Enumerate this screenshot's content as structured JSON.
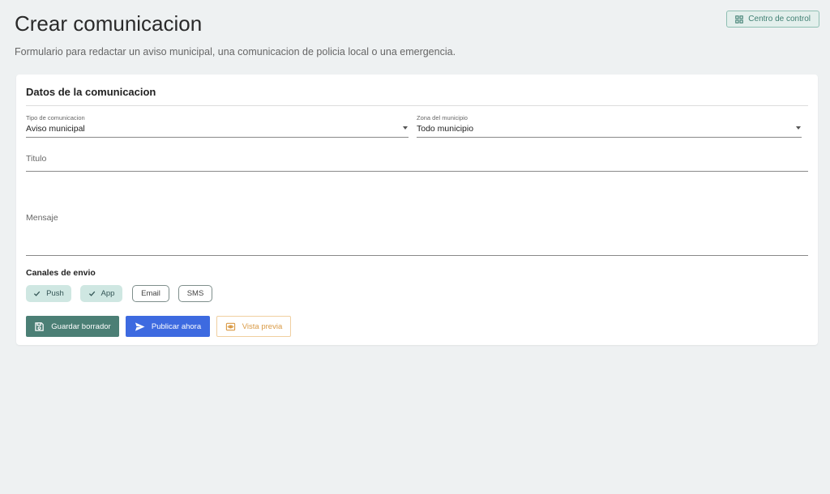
{
  "header": {
    "title": "Crear comunicacion",
    "subtitle": "Formulario para redactar un aviso municipal, una comunicacion de policia local o una emergencia.",
    "dashboard_label": "Centro de control"
  },
  "form": {
    "section_title": "Datos de la comunicacion",
    "type_select": {
      "label": "Tipo de comunicacion",
      "value": "Aviso municipal"
    },
    "zone_select": {
      "label": "Zona del municipio",
      "value": "Todo municipio"
    },
    "title_field": {
      "label": "Titulo",
      "value": ""
    },
    "message_field": {
      "label": "Mensaje",
      "value": ""
    },
    "channels_title": "Canales de envio",
    "channels": [
      {
        "label": "Push",
        "selected": true
      },
      {
        "label": "App",
        "selected": true
      },
      {
        "label": "Email",
        "selected": false
      },
      {
        "label": "SMS",
        "selected": false
      }
    ]
  },
  "actions": {
    "save_draft_label": "Guardar borrador",
    "publish_label": "Publicar ahora",
    "preview_label": "Vista previa"
  },
  "icons": {
    "dashboard": "grid-icon",
    "check": "check-icon",
    "save": "floppy-disk-icon",
    "publish": "send-icon",
    "preview": "eye-icon"
  },
  "colors": {
    "primary_teal": "#4b7f75",
    "publish_blue": "#3d6ae0",
    "preview_orange": "#d99a45",
    "chip_selected": "#cfe7e2",
    "background": "#eef1f2"
  }
}
